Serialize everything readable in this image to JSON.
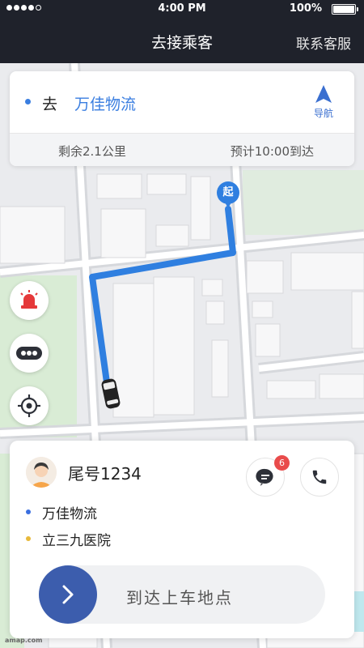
{
  "status_bar": {
    "time": "4:00 PM",
    "battery": "100%",
    "battery_level": 1.0
  },
  "nav_bar": {
    "title": "去接乘客",
    "service": "联系客服"
  },
  "destination": {
    "prefix": "去",
    "name": "万佳物流",
    "nav_label": "导航",
    "remaining": "剩余2.1公里",
    "eta": "预计10:00到达"
  },
  "map": {
    "start_marker": "起",
    "route_color": "#2f7fe0"
  },
  "side_buttons": [
    {
      "icon": "alarm-icon"
    },
    {
      "icon": "more-icon"
    },
    {
      "icon": "locate-icon"
    }
  ],
  "passenger": {
    "tail_number": "尾号1234",
    "message_count": "6",
    "stops": [
      {
        "name": "万佳物流",
        "color": "#3a6fe0"
      },
      {
        "name": "立三九医院",
        "color": "#e8b93a"
      }
    ],
    "slider_label": "到达上车地点"
  },
  "watermark": "amap.com"
}
